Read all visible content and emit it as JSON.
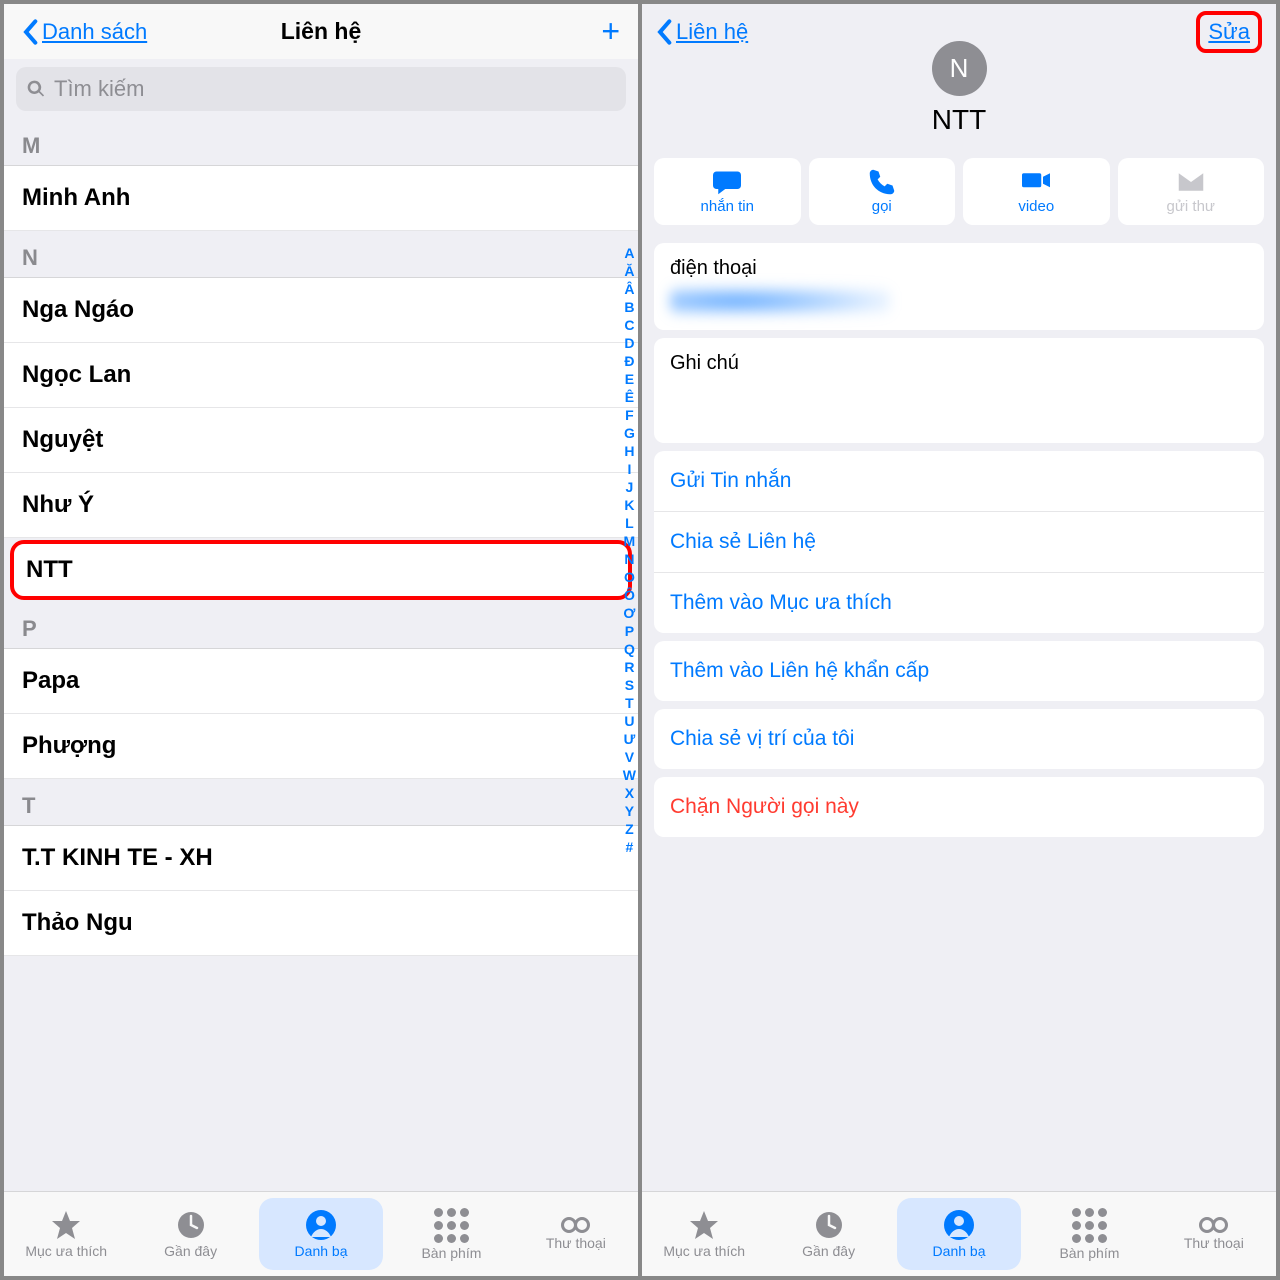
{
  "left": {
    "back": "Danh sách",
    "title": "Liên hệ",
    "search_placeholder": "Tìm kiếm",
    "sections": {
      "M": [
        "Minh Anh"
      ],
      "N": [
        "Nga Ngáo",
        "Ngọc Lan",
        "Nguyệt",
        "Như Ý",
        "NTT"
      ],
      "P": [
        "Papa",
        "Phượng"
      ],
      "T": [
        "T.T KINH TE - XH",
        "Thảo Ngu"
      ]
    },
    "highlighted": "NTT",
    "index_rail": [
      "A",
      "Ă",
      "Â",
      "B",
      "C",
      "D",
      "Đ",
      "E",
      "Ê",
      "F",
      "G",
      "H",
      "I",
      "J",
      "K",
      "L",
      "M",
      "N",
      "O",
      "Ô",
      "Ơ",
      "P",
      "Q",
      "R",
      "S",
      "T",
      "U",
      "Ư",
      "V",
      "W",
      "X",
      "Y",
      "Z",
      "#"
    ]
  },
  "right": {
    "back": "Liên hệ",
    "edit": "Sửa",
    "avatar_initial": "N",
    "name": "NTT",
    "actions": [
      {
        "label": "nhắn tin",
        "icon": "message",
        "disabled": false
      },
      {
        "label": "gọi",
        "icon": "phone",
        "disabled": false
      },
      {
        "label": "video",
        "icon": "video",
        "disabled": false
      },
      {
        "label": "gửi thư",
        "icon": "mail",
        "disabled": true
      }
    ],
    "phone_label": "điện thoại",
    "notes_label": "Ghi chú",
    "options_a": [
      "Gửi Tin nhắn",
      "Chia sẻ Liên hệ",
      "Thêm vào Mục ưa thích"
    ],
    "options_b": [
      "Thêm vào Liên hệ khẩn cấp"
    ],
    "options_c": [
      "Chia sẻ vị trí của tôi"
    ],
    "options_d": [
      "Chặn Người gọi này"
    ]
  },
  "tabs": [
    "Mục ưa thích",
    "Gần đây",
    "Danh bạ",
    "Bàn phím",
    "Thư thoại"
  ],
  "active_tab": 2
}
